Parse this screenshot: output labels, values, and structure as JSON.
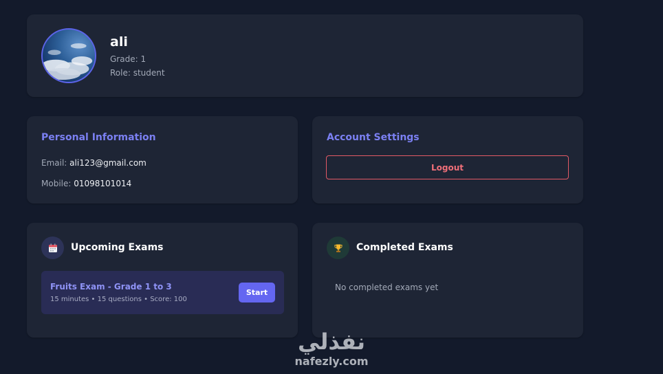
{
  "profile": {
    "name": "ali",
    "grade": "Grade: 1",
    "role": "Role: student"
  },
  "personal_info": {
    "title": "Personal Information",
    "email_label": "Email:",
    "email_value": "ali123@gmail.com",
    "mobile_label": "Mobile:",
    "mobile_value": "01098101014"
  },
  "account_settings": {
    "title": "Account Settings",
    "logout_label": "Logout"
  },
  "upcoming_exams": {
    "title": "Upcoming Exams",
    "icon": "calendar-icon",
    "items": [
      {
        "title": "Fruits Exam - Grade 1 to 3",
        "meta": "15 minutes • 15 questions • Score: 100",
        "action_label": "Start"
      }
    ]
  },
  "completed_exams": {
    "title": "Completed Exams",
    "icon": "trophy-icon",
    "empty_text": "No completed exams yet"
  },
  "watermark": {
    "arabic": "نفذلي",
    "latin": "nafezly.com"
  },
  "colors": {
    "background": "#131a2b",
    "card": "#1e2535",
    "accent": "#6466f1",
    "accent_text": "#7b80f2",
    "danger": "#e35a66"
  }
}
